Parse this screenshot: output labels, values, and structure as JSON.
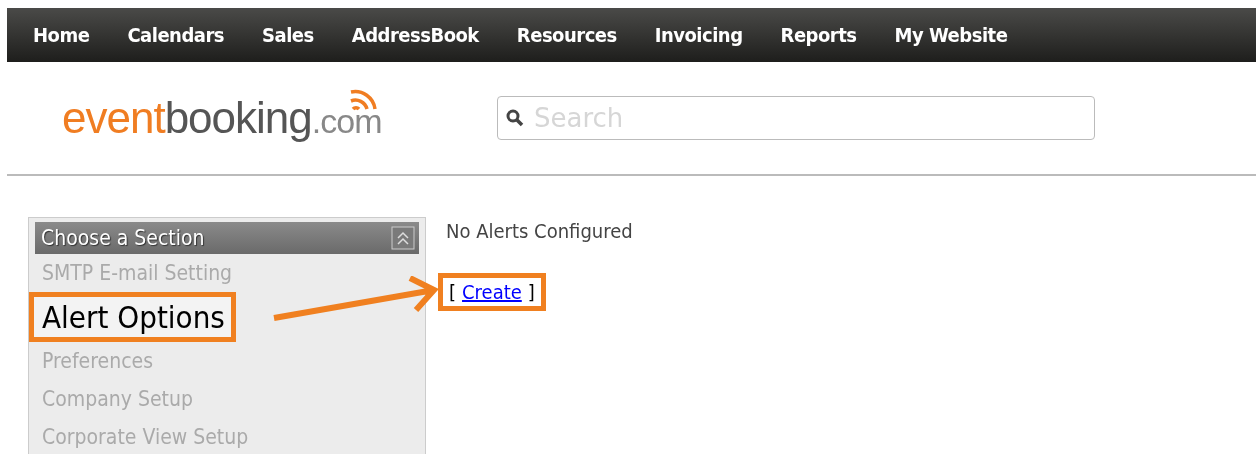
{
  "nav": [
    {
      "label": "Home"
    },
    {
      "label": "Calendars"
    },
    {
      "label": "Sales"
    },
    {
      "label": "AddressBook"
    },
    {
      "label": "Resources"
    },
    {
      "label": "Invoicing"
    },
    {
      "label": "Reports"
    },
    {
      "label": "My Website"
    }
  ],
  "logo": {
    "part_1": "event",
    "part_2": "booking",
    "part_3": ".com"
  },
  "search": {
    "placeholder": "Search"
  },
  "sidebar": {
    "title": "Choose a Section",
    "items": [
      {
        "label": "SMTP E-mail Setting",
        "selected": false
      },
      {
        "label": "Alert Options",
        "selected": true
      },
      {
        "label": "Preferences",
        "selected": false
      },
      {
        "label": "Company Setup",
        "selected": false
      },
      {
        "label": "Corporate View Setup",
        "selected": false
      }
    ]
  },
  "content": {
    "message": "No Alerts Configured",
    "open_bracket": "[",
    "link": "Create",
    "close_bracket": "]"
  }
}
